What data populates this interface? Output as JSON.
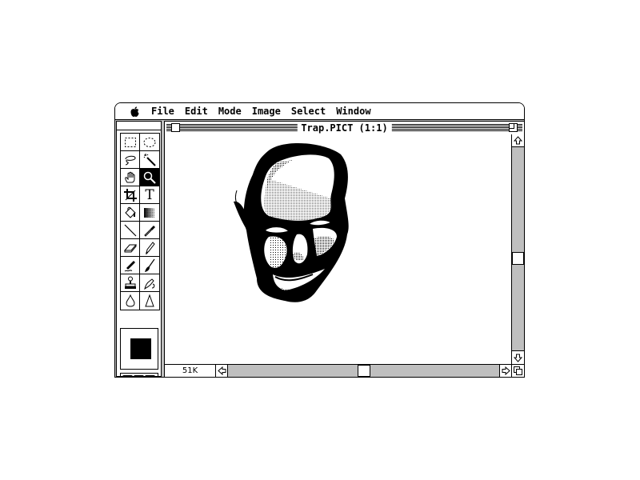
{
  "menubar": {
    "apple_icon": "apple-icon",
    "items": [
      "File",
      "Edit",
      "Mode",
      "Image",
      "Select",
      "Window"
    ]
  },
  "toolbox": {
    "tools": [
      {
        "name": "rectangular-marquee",
        "icon": "marquee-rect-icon"
      },
      {
        "name": "elliptical-marquee",
        "icon": "marquee-ellipse-icon"
      },
      {
        "name": "lasso",
        "icon": "lasso-icon"
      },
      {
        "name": "magic-wand",
        "icon": "magic-wand-icon"
      },
      {
        "name": "hand",
        "icon": "hand-icon"
      },
      {
        "name": "zoom",
        "icon": "magnifier-icon",
        "active": true
      },
      {
        "name": "crop",
        "icon": "crop-icon"
      },
      {
        "name": "type",
        "icon": "type-icon",
        "label": "T"
      },
      {
        "name": "paint-bucket",
        "icon": "paint-bucket-icon"
      },
      {
        "name": "gradient",
        "icon": "gradient-icon"
      },
      {
        "name": "line",
        "icon": "line-icon"
      },
      {
        "name": "eyedropper",
        "icon": "eyedropper-icon"
      },
      {
        "name": "eraser",
        "icon": "eraser-icon"
      },
      {
        "name": "pencil",
        "icon": "pencil-icon"
      },
      {
        "name": "airbrush",
        "icon": "airbrush-icon"
      },
      {
        "name": "paintbrush",
        "icon": "paintbrush-icon"
      },
      {
        "name": "rubber-stamp",
        "icon": "stamp-icon"
      },
      {
        "name": "smudge",
        "icon": "smudge-icon"
      },
      {
        "name": "blur",
        "icon": "blur-drop-icon"
      },
      {
        "name": "sharpen",
        "icon": "sharpen-icon"
      }
    ],
    "colors": {
      "foreground": "#000000",
      "background": "#ffffff"
    },
    "screen_modes": [
      "standard-window",
      "full-screen-menubar",
      "full-screen"
    ]
  },
  "document": {
    "title": "Trap.PICT  (1:1)",
    "memory": "51K",
    "vertical_scroll": 0.55,
    "horizontal_scroll": 0.5
  }
}
